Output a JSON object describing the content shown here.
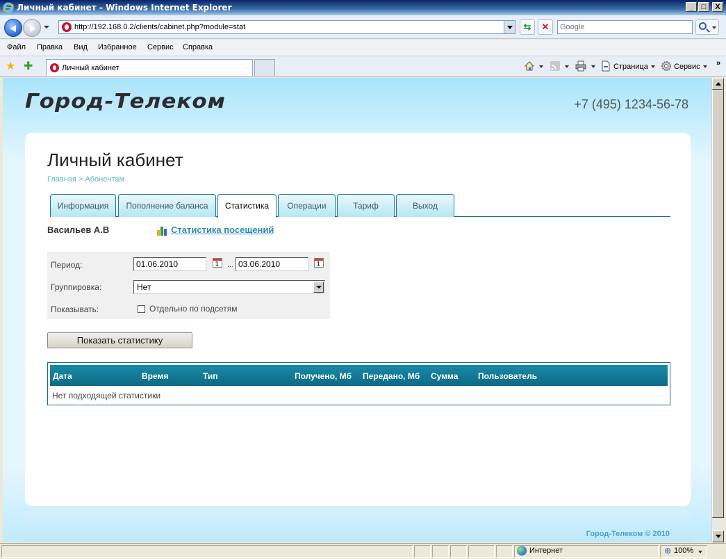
{
  "window": {
    "title": "Личный кабинет - Windows Internet Explorer",
    "minimize": "_",
    "maximize": "□",
    "close": "X"
  },
  "navbar": {
    "url": "http://192.168.0.2/clients/cabinet.php?module=stat",
    "search_placeholder": "Google",
    "refresh_glyph": "⇆",
    "stop_glyph": "✕"
  },
  "menu": [
    "Файл",
    "Правка",
    "Вид",
    "Избранное",
    "Сервис",
    "Справка"
  ],
  "tabbar": {
    "tab_title": "Личный кабинет",
    "page_cmd": "Страница",
    "tools_cmd": "Сервис",
    "more": "»"
  },
  "site": {
    "logo_text": "Город-Телеком",
    "phone": "+7 (495) 1234-56-78"
  },
  "page": {
    "title": "Личный кабинет",
    "breadcrumb_home": "Главная",
    "breadcrumb_sep": " > ",
    "breadcrumb_current": "Абонентам"
  },
  "tabs": [
    {
      "label": "Информация",
      "active": false
    },
    {
      "label": "Пополнение баланса",
      "active": false
    },
    {
      "label": "Статистика",
      "active": true
    },
    {
      "label": "Операции",
      "active": false
    },
    {
      "label": "Тариф",
      "active": false
    },
    {
      "label": "Выход",
      "active": false
    }
  ],
  "user": {
    "name": "Васильев А.В",
    "stat_link": "Статистика посещений"
  },
  "filter": {
    "period_label": "Период:",
    "date_from": "01.06.2010",
    "date_to": "03.06.2010",
    "range_sep": "...",
    "cal_glyph": "1",
    "grouping_label": "Группировка:",
    "grouping_value": "Нет",
    "show_label": "Показывать:",
    "subnet_checkbox_label": "Отдельно по подсетям",
    "subnet_checked": false
  },
  "show_button": "Показать статистику",
  "results": {
    "columns": [
      "Дата",
      "Время",
      "Тип",
      "Получено, Мб",
      "Передано, Мб",
      "Сумма",
      "Пользователь"
    ],
    "empty_text": "Нет подходящей статистики"
  },
  "footer": {
    "copyright": "Город-Телеком © 2010"
  },
  "status": {
    "zone": "Интернет",
    "zoom": "100%"
  },
  "colors": {
    "accent": "#0f6a86",
    "link": "#2b8cb4",
    "breadcrumb": "#5ab4d2",
    "page_bg": "#e4f6fe"
  }
}
